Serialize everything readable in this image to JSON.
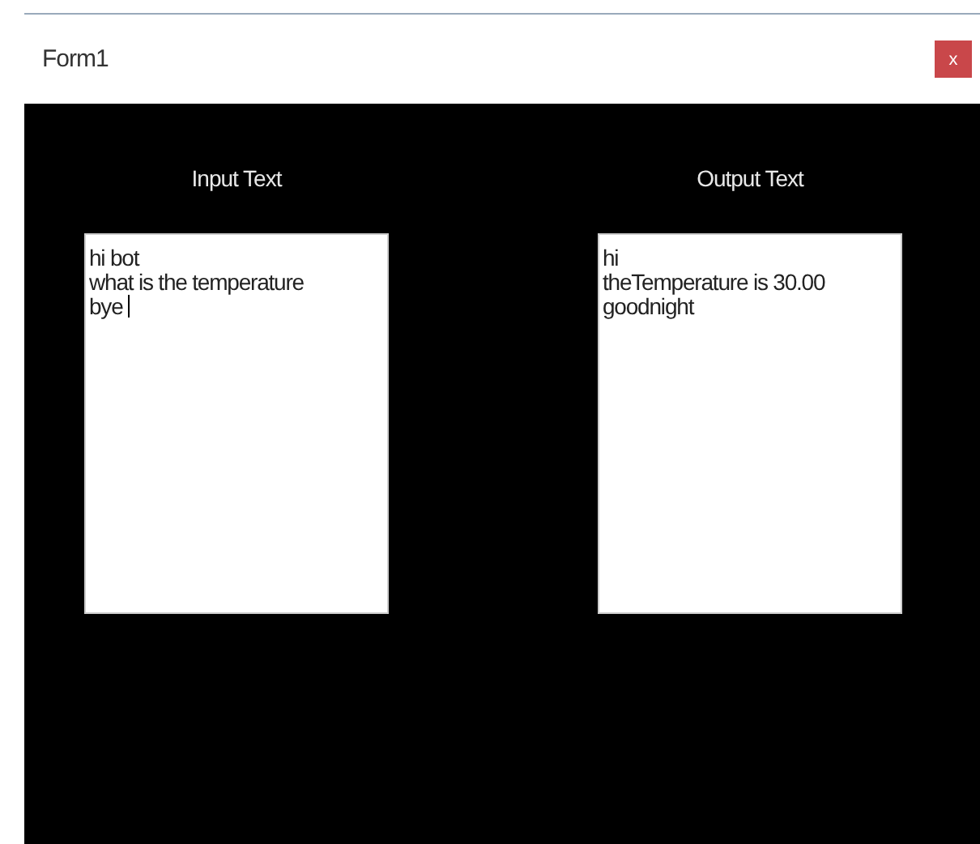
{
  "window": {
    "title": "Form1",
    "close_label": "x"
  },
  "panels": [
    {
      "label": "Input Text",
      "lines": [
        "hi bot",
        "what is the temperature",
        "bye "
      ],
      "focused": true
    },
    {
      "label": "Output Text",
      "lines": [
        "hi",
        "theTemperature is 30.00",
        "goodnight"
      ],
      "focused": false
    }
  ]
}
